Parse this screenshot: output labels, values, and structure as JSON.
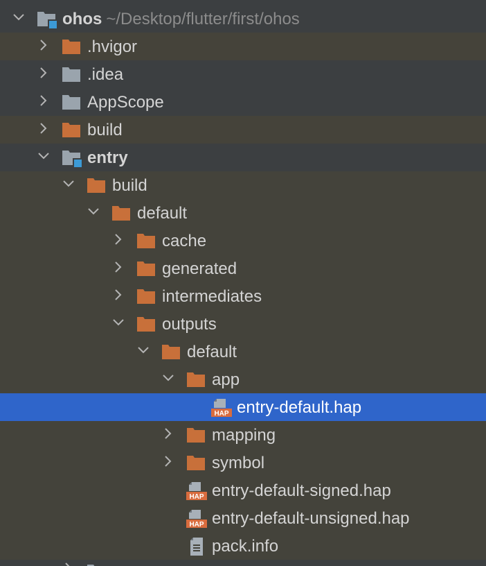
{
  "colors": {
    "folder_orange": "#c8703a",
    "folder_gray": "#9aa4ad",
    "module_marker": "#3c9ad6",
    "hap_badge": "#d96c3e",
    "selection": "#2f65ca",
    "text": "#d4d4d4",
    "path_text": "#8c8c8c"
  },
  "tree": {
    "root": {
      "label": "ohos",
      "path": "~/Desktop/flutter/first/ohos",
      "icon": "module-folder-icon",
      "expanded": true
    },
    "items": [
      {
        "label": ".hvigor",
        "icon": "folder-orange-icon",
        "expanded": false
      },
      {
        "label": ".idea",
        "icon": "folder-gray-icon",
        "expanded": false
      },
      {
        "label": "AppScope",
        "icon": "folder-gray-icon",
        "expanded": false
      },
      {
        "label": "build",
        "icon": "folder-orange-icon",
        "expanded": false
      },
      {
        "label": "entry",
        "icon": "module-folder-icon",
        "expanded": true
      },
      {
        "label": "build",
        "icon": "folder-orange-icon",
        "expanded": true
      },
      {
        "label": "default",
        "icon": "folder-orange-icon",
        "expanded": true
      },
      {
        "label": "cache",
        "icon": "folder-orange-icon",
        "expanded": false
      },
      {
        "label": "generated",
        "icon": "folder-orange-icon",
        "expanded": false
      },
      {
        "label": "intermediates",
        "icon": "folder-orange-icon",
        "expanded": false
      },
      {
        "label": "outputs",
        "icon": "folder-orange-icon",
        "expanded": true
      },
      {
        "label": "default",
        "icon": "folder-orange-icon",
        "expanded": true
      },
      {
        "label": "app",
        "icon": "folder-orange-icon",
        "expanded": true
      },
      {
        "label": "entry-default.hap",
        "icon": "hap-file-icon",
        "selected": true
      },
      {
        "label": "mapping",
        "icon": "folder-orange-icon",
        "expanded": false
      },
      {
        "label": "symbol",
        "icon": "folder-orange-icon",
        "expanded": false
      },
      {
        "label": "entry-default-signed.hap",
        "icon": "hap-file-icon"
      },
      {
        "label": "entry-default-unsigned.hap",
        "icon": "hap-file-icon"
      },
      {
        "label": "pack.info",
        "icon": "text-file-icon"
      }
    ],
    "hap_badge_text": "HAP"
  }
}
